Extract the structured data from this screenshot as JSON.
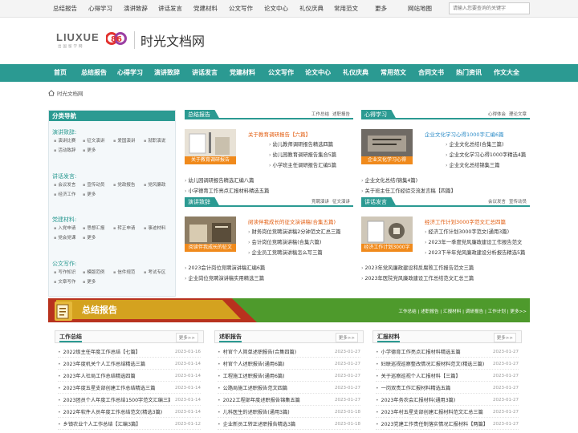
{
  "topbar": {
    "links": [
      "总结报告",
      "心得学习",
      "演讲致辞",
      "讲话发言",
      "党建材料",
      "公文写作",
      "论文中心",
      "礼仪庆典",
      "常用范文",
      "更多",
      "网站地图"
    ],
    "search_placeholder": "请输入您要查询的关键字"
  },
  "logo": {
    "text": "LIUXUE",
    "mark": "86",
    "sub": "出国留学网",
    "site_name": "时光文档网"
  },
  "mainnav": [
    "首页",
    "总结报告",
    "心得学习",
    "演讲致辞",
    "讲话发言",
    "党建材料",
    "公文写作",
    "论文中心",
    "礼仪庆典",
    "常用范文",
    "合同文书",
    "热门资讯",
    "作文大全"
  ],
  "breadcrumb": "时光文档网",
  "sidebar": {
    "title": "分类导航",
    "groups": [
      {
        "title": "演讲致辞:",
        "rows": [
          [
            "演讲比赛",
            "征文演讲",
            "爱国演讲",
            "就职演说"
          ],
          [
            "活动致辞",
            "更多"
          ]
        ]
      },
      {
        "title": "讲话发言:",
        "rows": [
          [
            "会议发言",
            "宣传动员",
            "党政报告",
            "党风廉政"
          ],
          [
            "经济工作",
            "更多"
          ]
        ]
      },
      {
        "title": "党建材料:",
        "rows": [
          [
            "入党申请",
            "思想汇报",
            "转正申请",
            "事迹材料"
          ],
          [
            "党会党课",
            "更多"
          ]
        ]
      },
      {
        "title": "公文写作:",
        "rows": [
          [
            "写作知识",
            "模版范例",
            "信件规范",
            "考试专区"
          ],
          [
            "文章写作",
            "更多"
          ]
        ]
      }
    ]
  },
  "boxes": [
    {
      "tag": "总结报告",
      "extras": [
        "工作总结",
        "述职报告"
      ],
      "thumb_caption": "关于教育调研报告",
      "headline": "关于教育调研报告【六篇】",
      "items": [
        "幼儿教师调研报告精选四篇",
        "幼儿园教育调研报告集合5篇",
        "小学班主任调研报告汇编5篇"
      ],
      "wide_items": [
        "幼儿园调研报告精选汇编八篇",
        "小学德育工作亮点汇报材料精选五篇"
      ]
    },
    {
      "tag": "心得学习",
      "extras": [
        "心得体会",
        "理论文章"
      ],
      "thumb_caption": "企业文化学习心得",
      "headline": "企业文化学习心得1000字汇编6篇",
      "items": [
        "企业文化总结(合集三篇)",
        "企业文化学习心得1000字精选4篇",
        "企业文化总结锦集三篇"
      ],
      "wide_items": [
        "企业文化总结(锦集4篇)",
        "关于班主任工作经验交流发言稿【四篇】"
      ]
    },
    {
      "tag": "演讲致辞",
      "extras": [
        "竞聘演讲",
        "征文演讲"
      ],
      "thumb_caption": "阅读伴我成长的征文",
      "headline": "阅读伴我成长的征文演讲稿(合集五篇)",
      "items": [
        "财务岗位竞聘演讲稿2分钟范文汇总三篇",
        "会计岗位竞聘演讲稿(合集六篇)",
        "企业员工竞聘演讲稿怎么写三篇"
      ],
      "wide_items": [
        "2023会计岗位竞聘演讲稿汇编6篇",
        "企业岗位竞聘演讲稿实用精选三篇"
      ]
    },
    {
      "tag": "讲话发言",
      "extras": [
        "会议发言",
        "宣传动员"
      ],
      "thumb_caption": "经济工作计划3000字",
      "headline": "经济工作计划3000字范文汇总四篇",
      "items": [
        "经济工作计划3000字范文(通用3篇)",
        "2023年一季度党风廉政建设工作报告范文",
        "2023下半年党风廉政建设分析报告精选5篇"
      ],
      "wide_items": [
        "2023年党风廉政建设和反腐败工作报告范文三篇",
        "2023年医院党风廉政建设工作总结范文汇总三篇"
      ]
    }
  ],
  "banner": {
    "title": "总结报告",
    "links": "工作总结 | 述职报告 | 汇报材料 | 调研报告 | 工作计划 | 更多>>"
  },
  "columns": [
    {
      "title": "工作总结",
      "more": "更多>>",
      "rows": [
        [
          "2022级主任年度工作总结【七篇】",
          "2023-01-16"
        ],
        [
          "2023年度机关个人工作总结精选三篇",
          "2023-01-14"
        ],
        [
          "2023年人社局工作总结精选四篇",
          "2023-01-14"
        ],
        [
          "2023年度五星支部创建工作总结精选三篇",
          "2023-01-14"
        ],
        [
          "2023团员个人年度工作总结1500字范文汇编三篇",
          "2023-01-14"
        ],
        [
          "2022年软件人员年度工作总结范文(精选3篇)",
          "2023-01-14"
        ],
        [
          "乡镇农业个人工作总结【汇编3篇】",
          "2023-01-12"
        ]
      ]
    },
    {
      "title": "述职报告",
      "more": "更多>>",
      "rows": [
        [
          "村官个人简单述职报告(合集四篇)",
          "2023-01-27"
        ],
        [
          "村官个人述职报告(通用6篇)",
          "2023-01-27"
        ],
        [
          "工程施工述职报告(通用6篇)",
          "2023-01-27"
        ],
        [
          "公路局施工述职报告范文四篇",
          "2023-01-27"
        ],
        [
          "2022工程部年度述职报告锦集五篇",
          "2023-01-27"
        ],
        [
          "儿科医生的述职报告(通用3篇)",
          "2023-01-18"
        ],
        [
          "企业新员工转正述职报告精选3篇",
          "2023-01-18"
        ]
      ]
    },
    {
      "title": "汇报材料",
      "more": "更多>>",
      "rows": [
        [
          "小学德育工作亮点汇报材料精选五篇",
          "2023-01-27"
        ],
        [
          "妇联巡视巡察整改情况汇报材料范文(精选三篇)",
          "2023-01-27"
        ],
        [
          "关于巡察巡视个人汇报材料【三篇】",
          "2023-01-27"
        ],
        [
          "一岗双责工作汇报材料精选五篇",
          "2023-01-27"
        ],
        [
          "2023年务农会汇报材料(通用3篇)",
          "2023-01-27"
        ],
        [
          "2023年村五星支部创建汇报材料范文汇总三篇",
          "2023-01-27"
        ],
        [
          "2023党建工作责任制落实情况汇报材料【两篇】",
          "2023-01-27"
        ]
      ]
    }
  ]
}
